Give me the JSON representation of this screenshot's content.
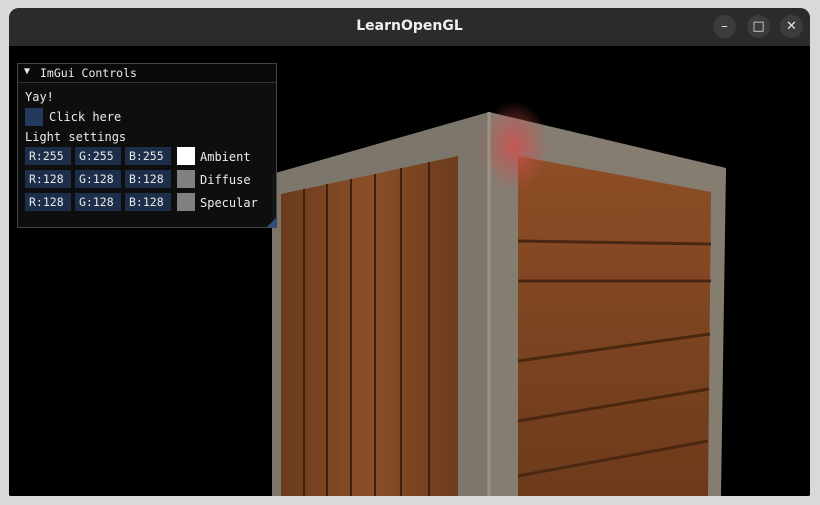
{
  "window": {
    "title": "LearnOpenGL",
    "controls": [
      "–",
      "□",
      "✕"
    ]
  },
  "imgui": {
    "title": "ImGui Controls",
    "yay_text": "Yay!",
    "button_label": "Click here",
    "section_label": "Light settings",
    "rows": [
      {
        "r": "R:255",
        "g": "G:255",
        "b": "B:255",
        "label": "Ambient",
        "color": "#ffffff"
      },
      {
        "r": "R:128",
        "g": "G:128",
        "b": "B:128",
        "label": "Diffuse",
        "color": "#808080"
      },
      {
        "r": "R:128",
        "g": "G:128",
        "b": "B:128",
        "label": "Specular",
        "color": "#808080"
      }
    ]
  }
}
